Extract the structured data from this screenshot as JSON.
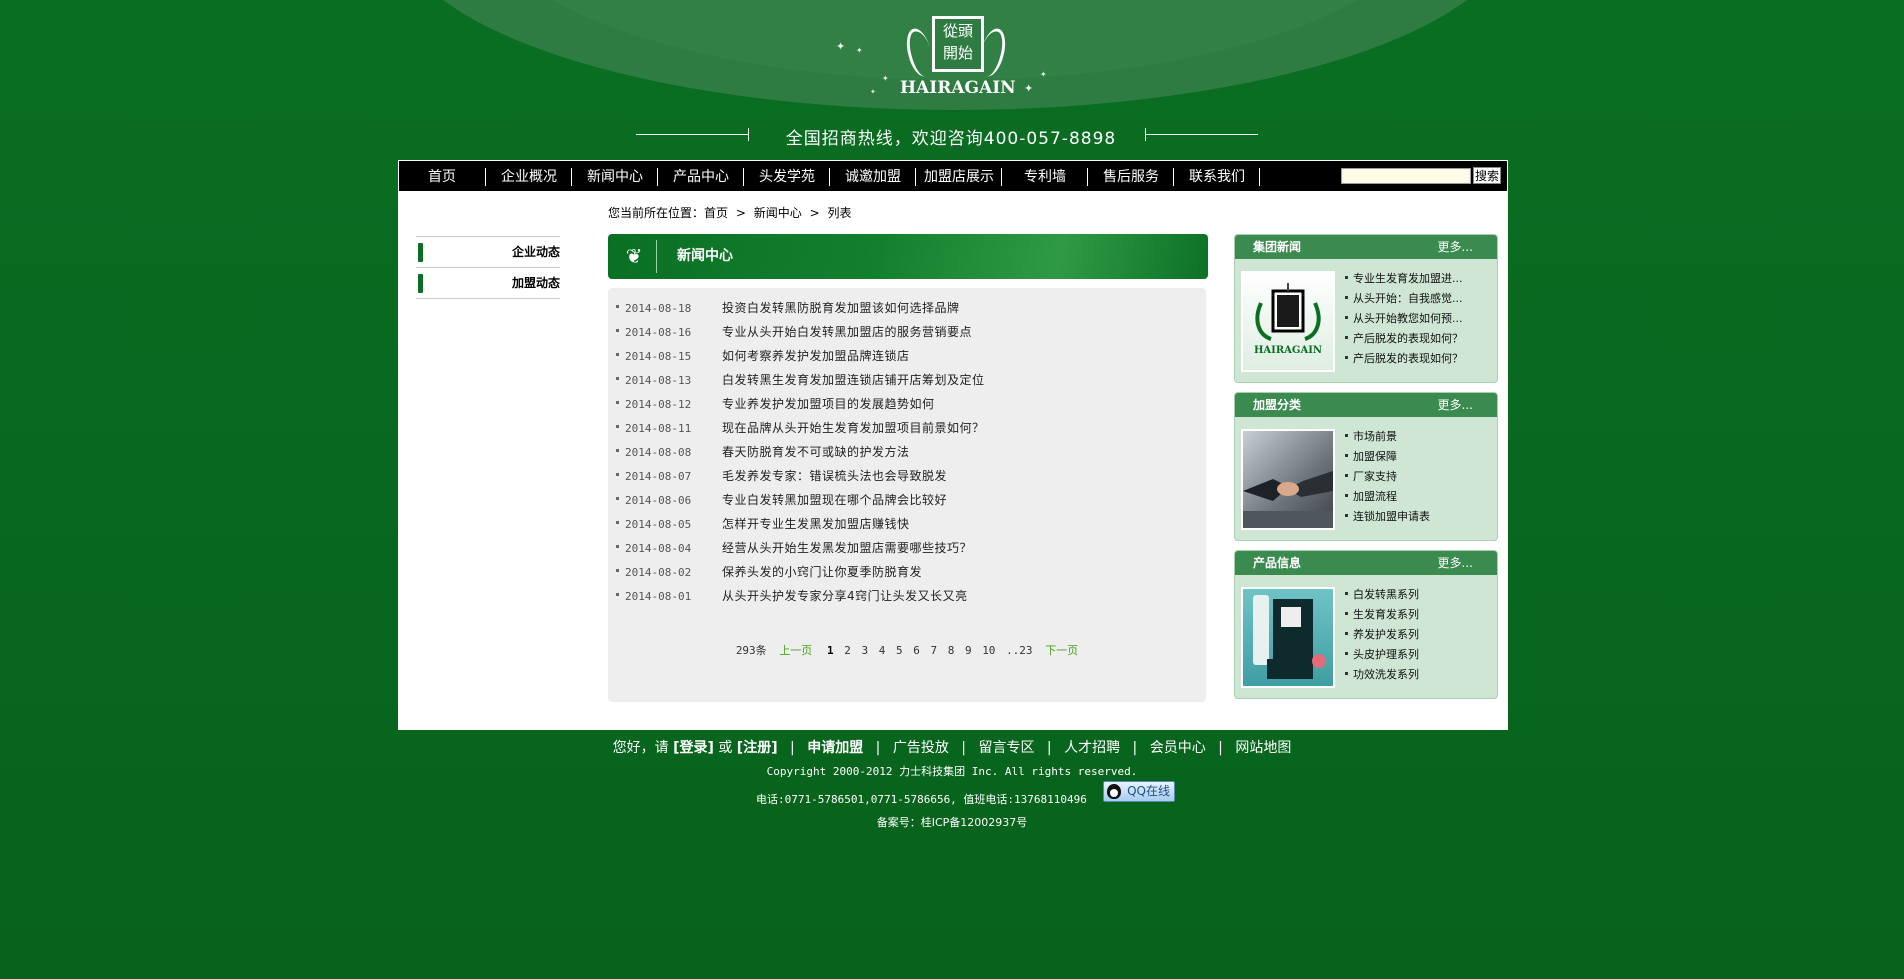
{
  "brand": {
    "logo_chars": "從頭開始",
    "logo_text": "HAIRAGAIN",
    "hotline": "全国招商热线，欢迎咨询400-057-8898"
  },
  "nav": {
    "items": [
      "首页",
      "企业概况",
      "新闻中心",
      "产品中心",
      "头发学苑",
      "诚邀加盟",
      "加盟店展示",
      "专利墙",
      "售后服务",
      "联系我们"
    ],
    "search_button": "搜索"
  },
  "breadcrumb": {
    "prefix": "您当前所在位置：",
    "items": [
      "首页",
      "新闻中心",
      "列表"
    ]
  },
  "sidebar": {
    "items": [
      "企业动态",
      "加盟动态"
    ]
  },
  "news": {
    "header": "新闻中心",
    "rows": [
      {
        "date": "2014-08-18",
        "title": "投资白发转黑防脱育发加盟该如何选择品牌"
      },
      {
        "date": "2014-08-16",
        "title": "专业从头开始白发转黑加盟店的服务营销要点"
      },
      {
        "date": "2014-08-15",
        "title": "如何考察养发护发加盟品牌连锁店"
      },
      {
        "date": "2014-08-13",
        "title": "白发转黑生发育发加盟连锁店铺开店筹划及定位"
      },
      {
        "date": "2014-08-12",
        "title": "专业养发护发加盟项目的发展趋势如何"
      },
      {
        "date": "2014-08-11",
        "title": "现在品牌从头开始生发育发加盟项目前景如何？"
      },
      {
        "date": "2014-08-08",
        "title": "春天防脱育发不可或缺的护发方法"
      },
      {
        "date": "2014-08-07",
        "title": "毛发养发专家：错误梳头法也会导致脱发"
      },
      {
        "date": "2014-08-06",
        "title": "专业白发转黑加盟现在哪个品牌会比较好"
      },
      {
        "date": "2014-08-05",
        "title": "怎样开专业生发黑发加盟店赚钱快"
      },
      {
        "date": "2014-08-04",
        "title": "经营从头开始生发黑发加盟店需要哪些技巧？"
      },
      {
        "date": "2014-08-02",
        "title": "保养头发的小窍门让你夏季防脱育发"
      },
      {
        "date": "2014-08-01",
        "title": "从头开头护发专家分享4窍门让头发又长又亮"
      }
    ],
    "pager": {
      "total": "293条",
      "prev": "上一页",
      "pages": [
        "1",
        "2",
        "3",
        "4",
        "5",
        "6",
        "7",
        "8",
        "9",
        "10",
        "..23"
      ],
      "current": "1",
      "next": "下一页"
    }
  },
  "panels": [
    {
      "title": "集团新闻",
      "more": "更多...",
      "thumb": "logo",
      "items": [
        "专业生发育发加盟进...",
        "从头开始：自我感觉...",
        "从头开始教您如何预...",
        "产后脱发的表现如何？",
        "产后脱发的表现如何？"
      ]
    },
    {
      "title": "加盟分类",
      "more": "更多...",
      "thumb": "handshake",
      "items": [
        "市场前景",
        "加盟保障",
        "厂家支持",
        "加盟流程",
        "连锁加盟申请表"
      ]
    },
    {
      "title": "产品信息",
      "more": "更多...",
      "thumb": "product",
      "items": [
        "白发转黑系列",
        "生发育发系列",
        "养发护发系列",
        "头皮护理系列",
        "功效洗发系列"
      ]
    }
  ],
  "footer": {
    "greeting": "您好，请",
    "login": "[登录]",
    "or": "或",
    "register": "[注册]",
    "links": [
      "申请加盟",
      "广告投放",
      "留言专区",
      "人才招聘",
      "会员中心",
      "网站地图"
    ],
    "copyright": "Copyright  2000-2012  力士科技集团  Inc. All rights reserved.",
    "phone": "电话:0771-5786501,0771-5786656,    值班电话:13768110496",
    "qq": "QQ在线",
    "icp": "备案号：桂ICP备12002937号"
  },
  "colors": {
    "bg": "#0a6f23",
    "accent": "#3b8a4f",
    "panel": "#cfe6d4"
  }
}
